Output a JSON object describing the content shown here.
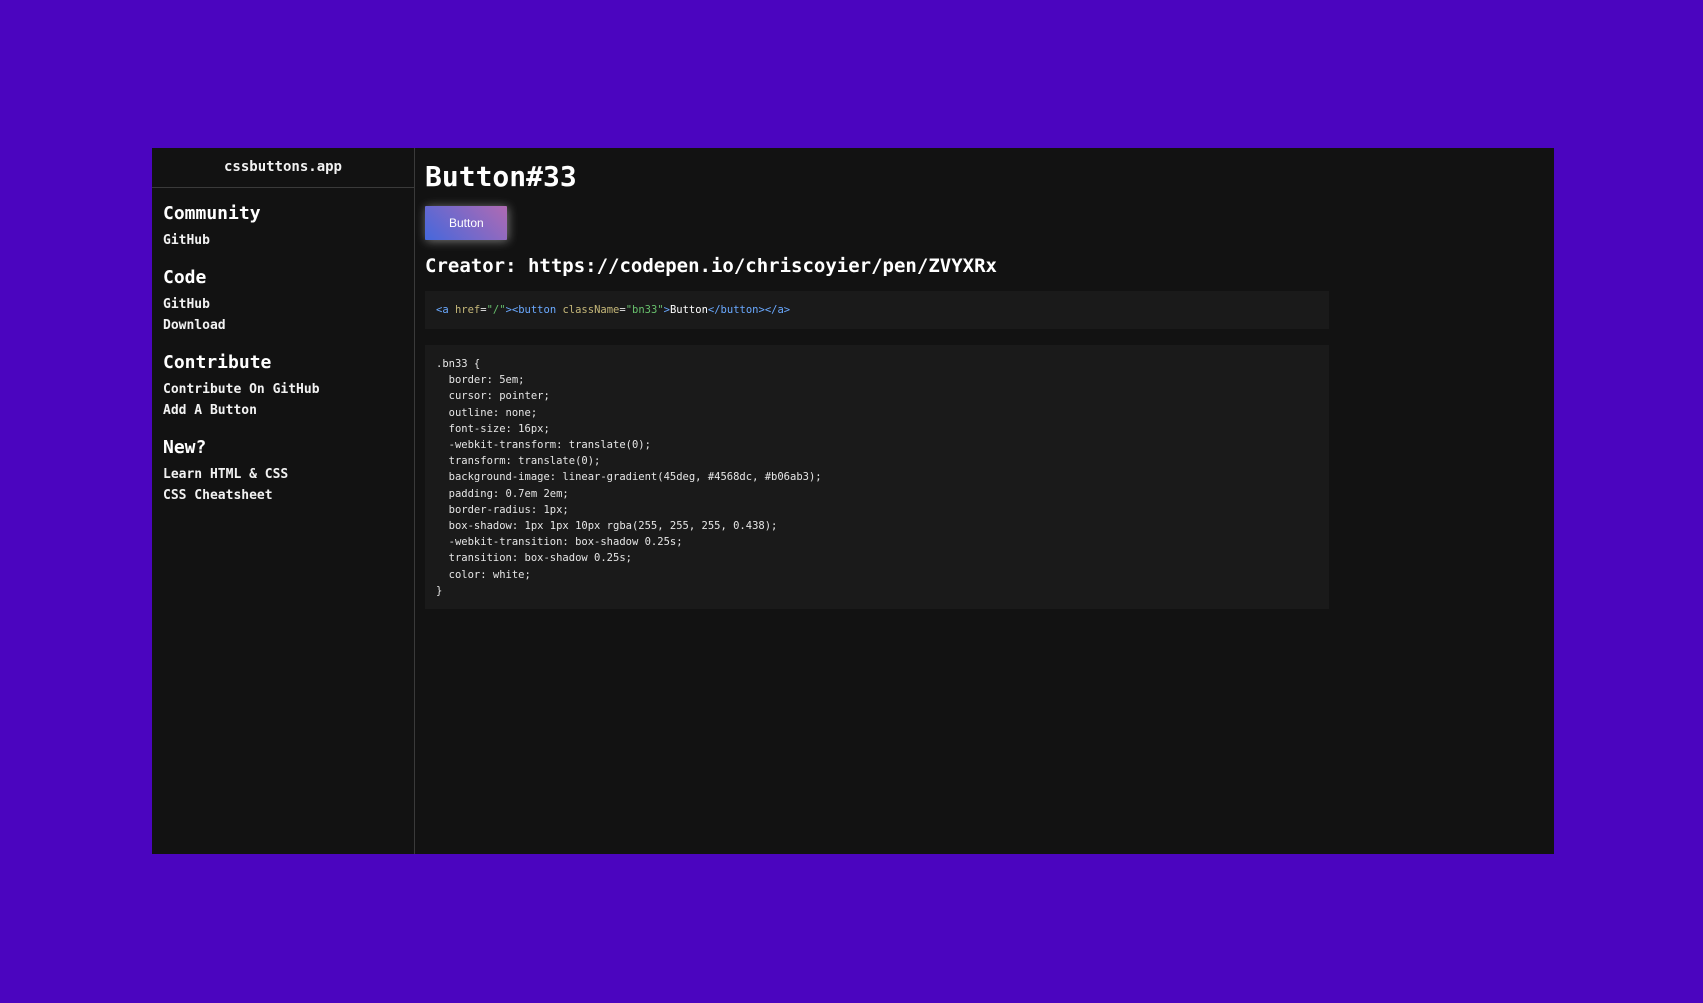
{
  "sidebar": {
    "brand": "cssbuttons.app",
    "sections": [
      {
        "title": "Community",
        "links": [
          "GitHub"
        ]
      },
      {
        "title": "Code",
        "links": [
          "GitHub",
          "Download"
        ]
      },
      {
        "title": "Contribute",
        "links": [
          "Contribute On GitHub",
          "Add A Button"
        ]
      },
      {
        "title": "New?",
        "links": [
          "Learn HTML & CSS",
          "CSS Cheatsheet"
        ]
      }
    ]
  },
  "main": {
    "title": "Button#33",
    "demo_button_label": "Button",
    "creator": "Creator: https://codepen.io/chriscoyier/pen/ZVYXRx",
    "html_snippet": {
      "open_a": "<a ",
      "href_attr": "href",
      "href_eq": "=",
      "href_val": "\"/\"",
      "gt1": ">",
      "open_button": "<button ",
      "class_attr": "className",
      "class_eq": "=",
      "class_val": "\"bn33\"",
      "gt2": ">",
      "text": "Button",
      "close_button": "</button>",
      "close_a": "</a>"
    },
    "css_lines": [
      ".bn33 {",
      "  border: 5em;",
      "  cursor: pointer;",
      "  outline: none;",
      "  font-size: 16px;",
      "  -webkit-transform: translate(0);",
      "  transform: translate(0);",
      "  background-image: linear-gradient(45deg, #4568dc, #b06ab3);",
      "  padding: 0.7em 2em;",
      "  border-radius: 1px;",
      "  box-shadow: 1px 1px 10px rgba(255, 255, 255, 0.438);",
      "  -webkit-transition: box-shadow 0.25s;",
      "  transition: box-shadow 0.25s;",
      "  color: white;",
      "}"
    ]
  },
  "colors": {
    "page_background": "#4b05bf",
    "panel_background": "#121212",
    "code_background": "#1a1a1a",
    "gradient_start": "#4568dc",
    "gradient_end": "#b06ab3"
  }
}
